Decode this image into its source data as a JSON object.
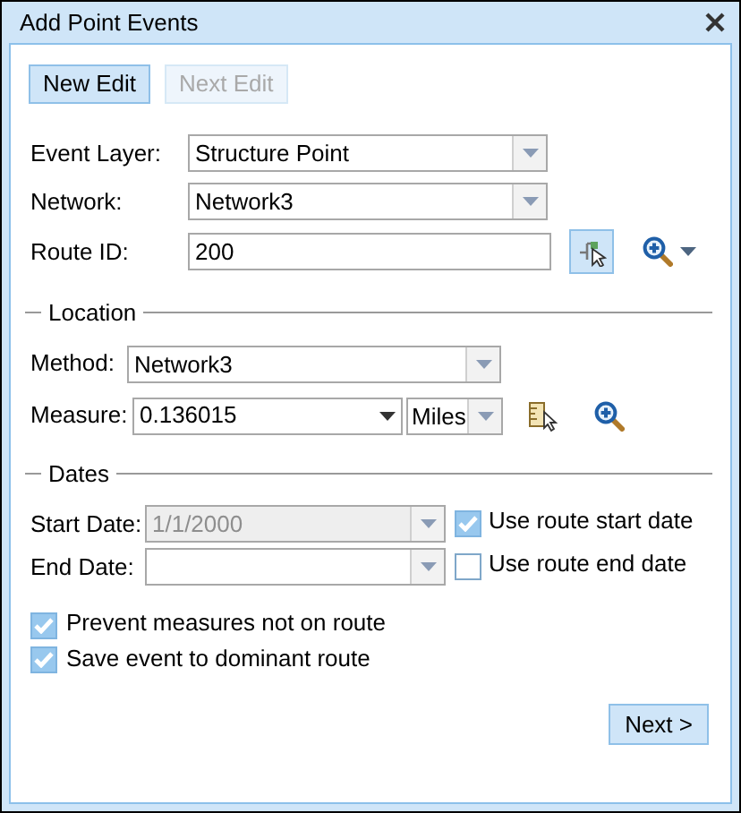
{
  "window": {
    "title": "Add Point Events"
  },
  "toolbar": [
    {
      "label": "New Edit",
      "disabled": false
    },
    {
      "label": "Next Edit",
      "disabled": true
    }
  ],
  "fields": [
    {
      "label": "Event Layer:",
      "value": "Structure Point",
      "kind": "combo"
    },
    {
      "label": "Network:",
      "value": "Network3",
      "kind": "combo"
    },
    {
      "label": "Route ID:",
      "value": "200",
      "kind": "text"
    }
  ],
  "location": {
    "title": "Location",
    "method": {
      "label": "Method:",
      "value": "Network3"
    },
    "measure": {
      "label": "Measure:",
      "value": "0.136015",
      "units": "Miles"
    }
  },
  "dates": {
    "title": "Dates",
    "rows": [
      {
        "label": "Start Date:",
        "value": "1/1/2000",
        "disabled": true,
        "option": "Use route start date",
        "checked": true
      },
      {
        "label": "End Date:",
        "disabled": false,
        "option": "Use route end date",
        "checked": false
      }
    ]
  },
  "options": [
    {
      "label": "Prevent measures not on route",
      "checked": true
    },
    {
      "label": "Save event to dominant route",
      "checked": true
    }
  ],
  "next_button": {
    "label": "Next >"
  }
}
